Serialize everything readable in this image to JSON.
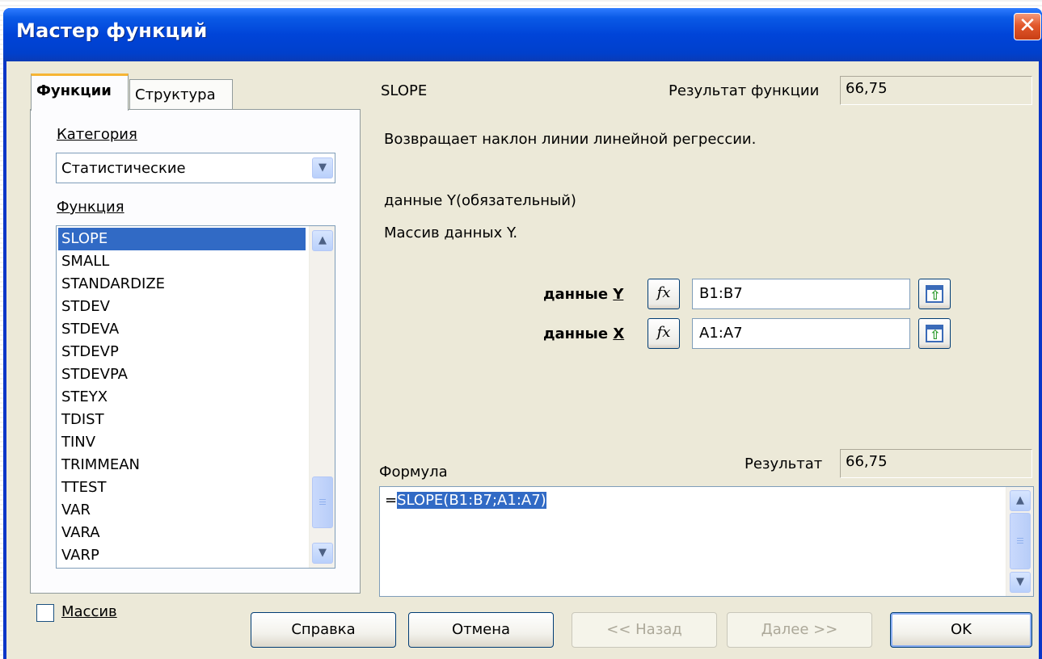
{
  "window": {
    "title": "Мастер функций",
    "close_glyph": "✕"
  },
  "tabs": [
    {
      "label": "Функции",
      "active": true
    },
    {
      "label": "Структура",
      "active": false
    }
  ],
  "category": {
    "label": "Категория",
    "value": "Статистические"
  },
  "functions": {
    "label": "Функция",
    "items": [
      "SLOPE",
      "SMALL",
      "STANDARDIZE",
      "STDEV",
      "STDEVA",
      "STDEVP",
      "STDEVPA",
      "STEYX",
      "TDIST",
      "TINV",
      "TRIMMEAN",
      "TTEST",
      "VAR",
      "VARA",
      "VARP"
    ],
    "selected": "SLOPE"
  },
  "function_info": {
    "name": "SLOPE",
    "result_label": "Результат функции",
    "result_value": "66,75",
    "description": "Возвращает наклон линии линейной регрессии.",
    "arg_title": "данные Y(обязательный)",
    "arg_description": "Массив данных Y."
  },
  "arguments": [
    {
      "label_prefix": "данные ",
      "label_key": "Y",
      "fx": "fx",
      "value": "B1:B7"
    },
    {
      "label_prefix": "данные ",
      "label_key": "X",
      "fx": "fx",
      "value": "A1:A7"
    }
  ],
  "formula": {
    "label": "Формула",
    "result_label": "Результат",
    "result_value": "66,75",
    "prefix": "=",
    "selected_text": "SLOPE(B1:B7;A1:A7)"
  },
  "array_checkbox": {
    "label": "Массив",
    "checked": false
  },
  "buttons": {
    "help": "Справка",
    "cancel": "Отмена",
    "back": "<< Назад",
    "next": "Далее >>",
    "ok": "OK"
  },
  "icons": {
    "scroll_up": "chevron-up-icon",
    "scroll_down": "chevron-down-icon",
    "shrink": "shrink-dialog-icon"
  }
}
